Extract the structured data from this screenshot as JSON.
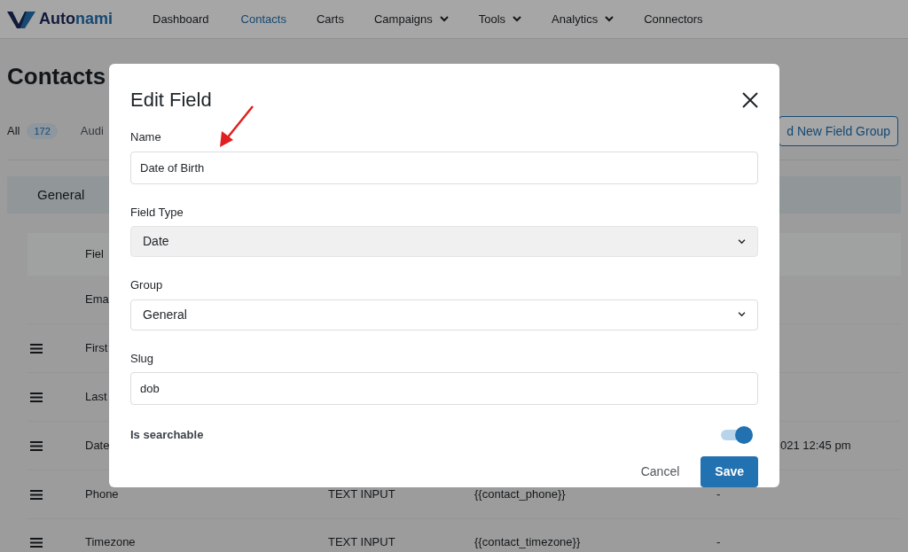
{
  "brand": {
    "name_start": "Auto",
    "name_end": "nami"
  },
  "nav": [
    {
      "label": "Dashboard",
      "selected": false,
      "dropdown": false
    },
    {
      "label": "Contacts",
      "selected": true,
      "dropdown": false
    },
    {
      "label": "Carts",
      "selected": false,
      "dropdown": false
    },
    {
      "label": "Campaigns",
      "selected": false,
      "dropdown": true
    },
    {
      "label": "Tools",
      "selected": false,
      "dropdown": true
    },
    {
      "label": "Analytics",
      "selected": false,
      "dropdown": true
    },
    {
      "label": "Connectors",
      "selected": false,
      "dropdown": false
    }
  ],
  "page_title": "Contacts",
  "filters": [
    {
      "label": "All",
      "count": "172",
      "selected": true
    },
    {
      "label": "Audi",
      "selected": false
    }
  ],
  "add_group_button": "d New Field Group",
  "group_tab": "General",
  "table": {
    "header": "Fiel",
    "rows": [
      {
        "name": "Ema",
        "handle": false
      },
      {
        "name": "First",
        "handle": true
      },
      {
        "name": "Last",
        "handle": true
      },
      {
        "name": "Date",
        "handle": true,
        "column_4": "021 12:45 pm"
      },
      {
        "name": "Phone",
        "handle": true,
        "type": "TEXT INPUT",
        "merge_tag": "{{contact_phone}}",
        "column_4": "-"
      },
      {
        "name": "Timezone",
        "handle": true,
        "type": "TEXT INPUT",
        "merge_tag": "{{contact_timezone}}",
        "column_4": "-"
      }
    ]
  },
  "modal": {
    "title": "Edit Field",
    "fields": [
      {
        "kind": "text",
        "label": "Name",
        "value": "Date of Birth"
      },
      {
        "kind": "select",
        "label": "Field Type",
        "value": "Date",
        "disabled": true
      },
      {
        "kind": "select",
        "label": "Group",
        "value": "General",
        "disabled": false
      },
      {
        "kind": "text",
        "label": "Slug",
        "value": "dob"
      },
      {
        "kind": "toggle",
        "label": "Is searchable",
        "on": true
      }
    ],
    "buttons": [
      {
        "label": "Cancel",
        "kind": "link"
      },
      {
        "label": "Save",
        "kind": "primary"
      }
    ]
  }
}
